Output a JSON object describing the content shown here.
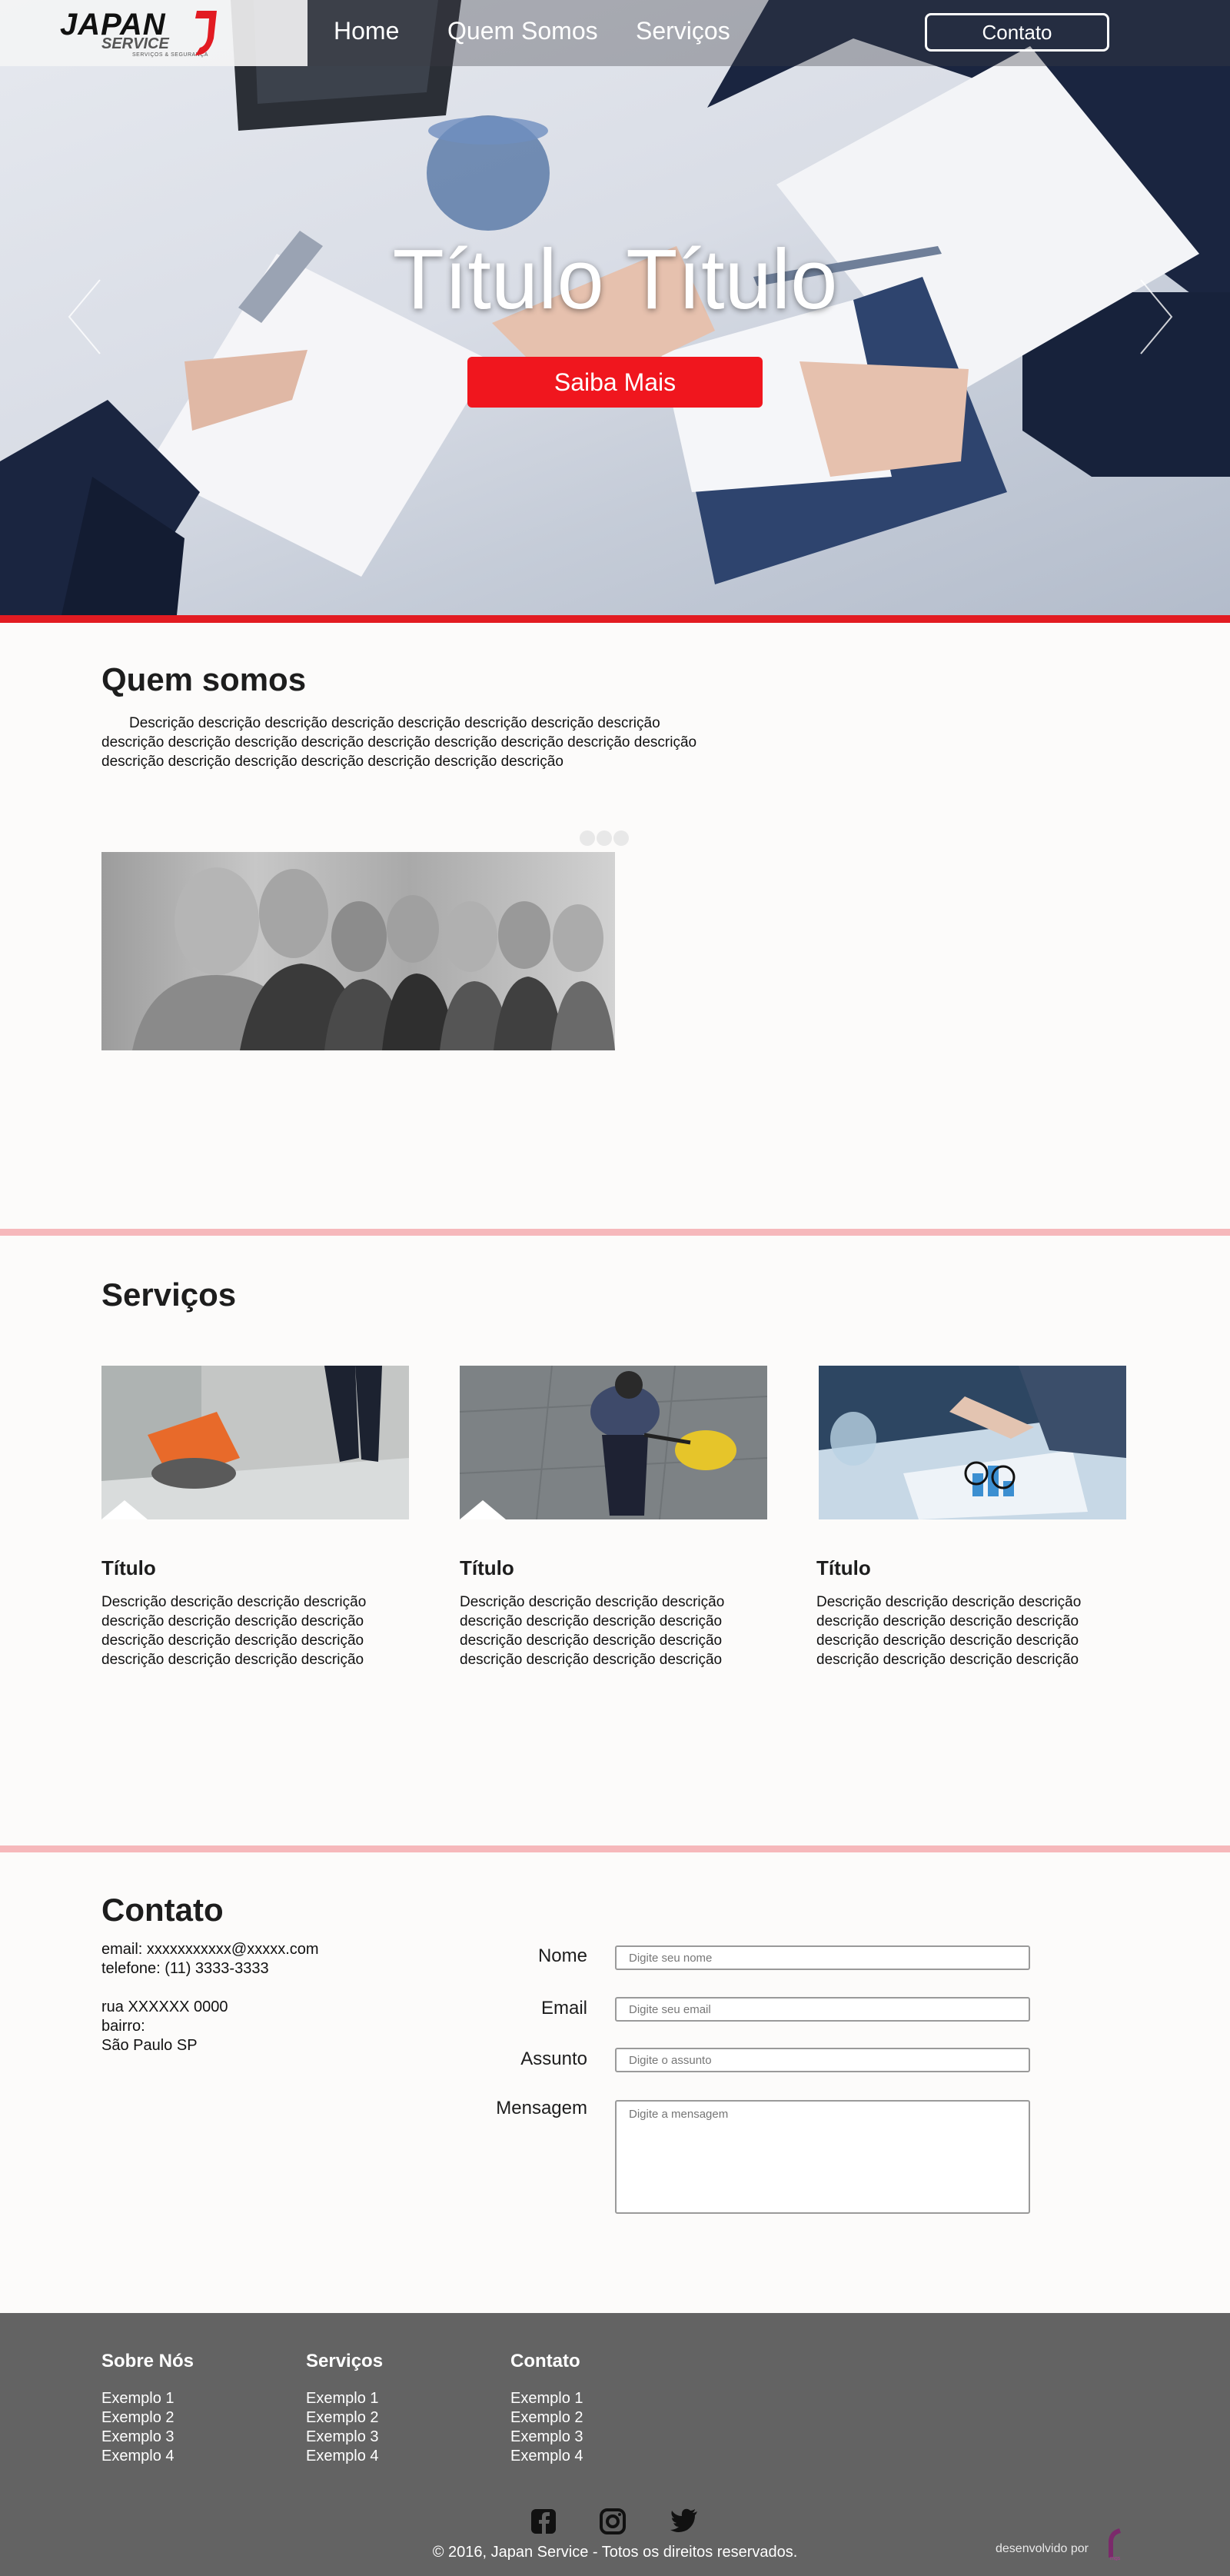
{
  "brand": {
    "name": "JAPAN",
    "sub": "SERVICE",
    "tag": "SERVIÇOS & SEGURANÇA"
  },
  "nav": {
    "items": [
      "Home",
      "Quem Somos",
      "Serviços"
    ],
    "contact_label": "Contato"
  },
  "hero": {
    "title": "Título Título",
    "cta_label": "Saiba Mais"
  },
  "about": {
    "title": "Quem somos",
    "text": "Descrição descrição descrição descrição descrição descrição descrição descrição descrição descrição descrição descrição descrição descrição descrição descrição descrição descrição descrição descrição descrição descrição descrição descrição"
  },
  "services": {
    "title": "Serviços",
    "items": [
      {
        "title": "Título",
        "desc": "Descrição descrição descrição descrição descrição descrição descrição descrição descrição descrição descrição descrição descrição descrição descrição descrição"
      },
      {
        "title": "Título",
        "desc": "Descrição descrição descrição descrição descrição descrição descrição descrição descrição descrição descrição descrição descrição descrição descrição descrição"
      },
      {
        "title": "Título",
        "desc": "Descrição descrição descrição descrição descrição descrição descrição descrição descrição descrição descrição descrição descrição descrição descrição descrição"
      }
    ]
  },
  "contact": {
    "title": "Contato",
    "email": "email: xxxxxxxxxxx@xxxxx.com",
    "phone": "telefone: (11) 3333-3333",
    "street": "rua XXXXXX 0000",
    "district": "bairro:",
    "city": "São Paulo SP",
    "form": {
      "name_label": "Nome",
      "name_placeholder": "Digite seu nome",
      "email_label": "Email",
      "email_placeholder": "Digite seu email",
      "subject_label": "Assunto",
      "subject_placeholder": "Digite o assunto",
      "message_label": "Mensagem",
      "message_placeholder": "Digite a mensagem"
    }
  },
  "footer": {
    "columns": [
      {
        "title": "Sobre Nós",
        "links": [
          "Exemplo 1",
          "Exemplo 2",
          "Exemplo 3",
          "Exemplo 4"
        ]
      },
      {
        "title": "Serviços",
        "links": [
          "Exemplo 1",
          "Exemplo 2",
          "Exemplo 3",
          "Exemplo 4"
        ]
      },
      {
        "title": "Contato",
        "links": [
          "Exemplo 1",
          "Exemplo 2",
          "Exemplo 3",
          "Exemplo 4"
        ]
      }
    ],
    "social_icons": [
      "facebook-icon",
      "instagram-icon",
      "twitter-icon"
    ],
    "copyright": "© 2016, Japan Service - Totos os direitos reservados.",
    "dev_label": "desenvolvido por"
  },
  "colors": {
    "accent": "#e21b22",
    "cta": "#f0161e",
    "divider": "#f6b8bb",
    "footer_bg": "#636363"
  }
}
